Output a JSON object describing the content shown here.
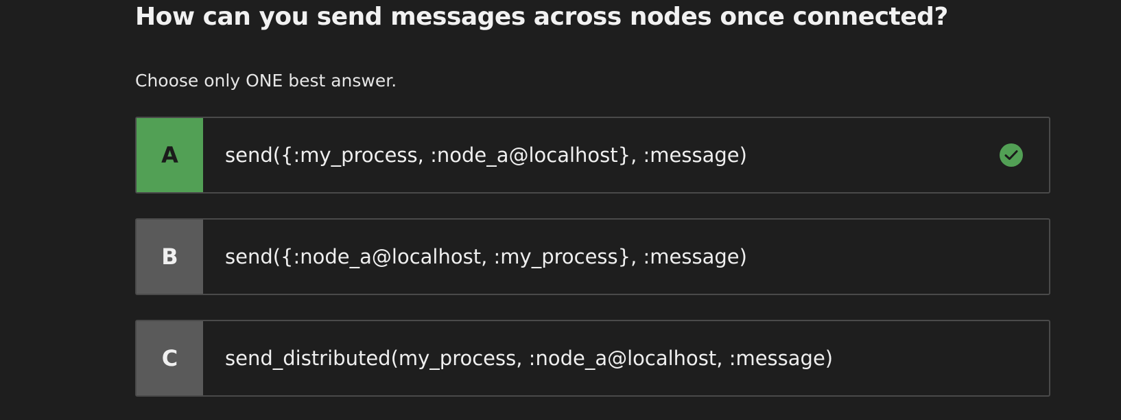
{
  "question": {
    "title": "How can you send messages across nodes once connected?",
    "instructions": "Choose only ONE best answer."
  },
  "options": [
    {
      "letter": "A",
      "text": "send({:my_process, :node_a@localhost}, :message)",
      "state": "correct"
    },
    {
      "letter": "B",
      "text": "send({:node_a@localhost, :my_process}, :message)",
      "state": "unselected"
    },
    {
      "letter": "C",
      "text": "send_distributed(my_process, :node_a@localhost, :message)",
      "state": "unselected"
    }
  ],
  "colors": {
    "background": "#1e1e1e",
    "correct_accent": "#52a055",
    "letter_neutral": "#5a5a5a",
    "border": "#4a4a4a"
  },
  "icons": {
    "correct_marker": "check-circle-icon"
  }
}
